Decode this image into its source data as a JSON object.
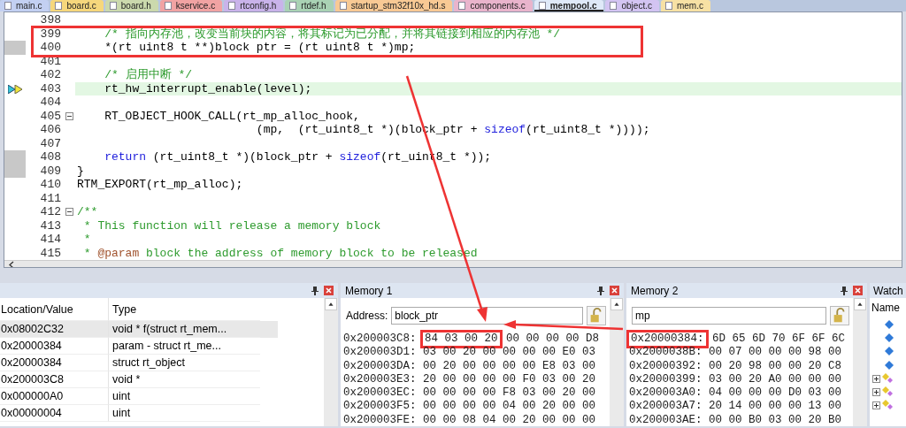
{
  "tabs": [
    {
      "label": "main.c",
      "color": "#c3d0f2",
      "selected": false
    },
    {
      "label": "board.c",
      "color": "#f6d77c",
      "selected": false
    },
    {
      "label": "board.h",
      "color": "#cbd9ad",
      "selected": false
    },
    {
      "label": "kservice.c",
      "color": "#f1a3a3",
      "selected": false
    },
    {
      "label": "rtconfig.h",
      "color": "#c9b3ea",
      "selected": false
    },
    {
      "label": "rtdef.h",
      "color": "#a9d2b4",
      "selected": false
    },
    {
      "label": "startup_stm32f10x_hd.s",
      "color": "#f8c994",
      "selected": false
    },
    {
      "label": "components.c",
      "color": "#e9b4cc",
      "selected": false
    },
    {
      "label": "mempool.c",
      "color": "#dfe9f8",
      "selected": true
    },
    {
      "label": "object.c",
      "color": "#d3c4f2",
      "selected": false
    },
    {
      "label": "mem.c",
      "color": "#f7e1a4",
      "selected": false
    }
  ],
  "editor": {
    "lines": [
      {
        "number": "398"
      },
      {
        "number": "399",
        "annotated": true,
        "tokens": [
          {
            "kind": "comment",
            "text": "    /* 指向内存池，改变当前块的内容，将其标记为已分配，并将其链接到相应的内存池 */"
          }
        ]
      },
      {
        "number": "400",
        "annotated": true,
        "gutter_mark": true,
        "tokens": [
          {
            "kind": "plain",
            "text": "    *(rt uint8 t **)block ptr = (rt uint8 t *)mp;"
          }
        ]
      },
      {
        "number": "401"
      },
      {
        "number": "402",
        "tokens": [
          {
            "kind": "comment",
            "text": "    /* 启用中断 */"
          }
        ]
      },
      {
        "number": "403",
        "current": true,
        "tokens": [
          {
            "kind": "plain",
            "text": "    rt_hw_interrupt_enable(level);"
          }
        ]
      },
      {
        "number": "404"
      },
      {
        "number": "405",
        "fold_expanded": true,
        "tokens": [
          {
            "kind": "plain",
            "text": "    RT_OBJECT_HOOK_CALL(rt_mp_alloc_hook,"
          }
        ]
      },
      {
        "number": "406",
        "tokens": [
          {
            "kind": "plain",
            "text": "                          (mp,  (rt_uint8_t *)(block_ptr + "
          },
          {
            "kind": "keyword",
            "text": "sizeof"
          },
          {
            "kind": "plain",
            "text": "(rt_uint8_t *))));"
          }
        ]
      },
      {
        "number": "407"
      },
      {
        "number": "408",
        "gutter_mark": true,
        "tokens": [
          {
            "kind": "keyword",
            "text": "    return"
          },
          {
            "kind": "plain",
            "text": " (rt_uint8_t *)(block_ptr + "
          },
          {
            "kind": "keyword",
            "text": "sizeof"
          },
          {
            "kind": "plain",
            "text": "(rt_uint8_t *));"
          }
        ]
      },
      {
        "number": "409",
        "gutter_mark": true,
        "tokens": [
          {
            "kind": "plain",
            "text": "}"
          }
        ]
      },
      {
        "number": "410",
        "tokens": [
          {
            "kind": "plain",
            "text": "RTM_EXPORT(rt_mp_alloc);"
          }
        ]
      },
      {
        "number": "411"
      },
      {
        "number": "412",
        "fold_expanded": true,
        "tokens": [
          {
            "kind": "comment",
            "text": "/**"
          }
        ]
      },
      {
        "number": "413",
        "tokens": [
          {
            "kind": "comment",
            "text": " * This function will release a memory block"
          }
        ]
      },
      {
        "number": "414",
        "tokens": [
          {
            "kind": "comment",
            "text": " *"
          }
        ]
      },
      {
        "number": "415",
        "tokens": [
          {
            "kind": "comment",
            "text": " * "
          },
          {
            "kind": "tag",
            "text": "@param"
          },
          {
            "kind": "comment",
            "text": " block the address of memory block to be released"
          }
        ]
      }
    ]
  },
  "call_stack": {
    "columns": [
      "Location/Value",
      "Type"
    ],
    "rows": [
      {
        "location": "0x08002C32",
        "type": "void * f(struct rt_mem...",
        "selected": true
      },
      {
        "location": "0x20000384",
        "type": "param - struct rt_me...",
        "selected": false
      },
      {
        "location": "0x20000384",
        "type": "struct rt_object",
        "selected": false
      },
      {
        "location": "0x200003C8",
        "type": "void *",
        "selected": false
      },
      {
        "location": "0x000000A0",
        "type": "uint",
        "selected": false
      },
      {
        "location": "0x00000004",
        "type": "uint",
        "selected": false
      }
    ]
  },
  "memory_1": {
    "title": "Memory 1",
    "address_label": "Address:",
    "address_value": "block_ptr",
    "rows": [
      {
        "address": "0x200003C8:",
        "boxed_bytes": "84 03 00 20",
        "bytes": "00 00 00 00 D8"
      },
      {
        "address": "0x200003D1:",
        "bytes": "03 00 20 00 00 00 00 E0 03"
      },
      {
        "address": "0x200003DA:",
        "bytes": "00 20 00 00 00 00 E8 03 00"
      },
      {
        "address": "0x200003E3:",
        "bytes": "20 00 00 00 00 F0 03 00 20"
      },
      {
        "address": "0x200003EC:",
        "bytes": "00 00 00 00 F8 03 00 20 00"
      },
      {
        "address": "0x200003F5:",
        "bytes": "00 00 00 00 04 00 20 00 00"
      },
      {
        "address": "0x200003FE:",
        "bytes": "00 00 08 04 00 20 00 00 00"
      }
    ]
  },
  "memory_2": {
    "title": "Memory 2",
    "address_value": "mp",
    "rows": [
      {
        "address": "0x20000384:",
        "address_boxed": true,
        "bytes": "6D 65 6D 70 6F 6F 6C"
      },
      {
        "address": "0x2000038B:",
        "bytes": "00 07 00 00 00 98 00"
      },
      {
        "address": "0x20000392:",
        "bytes": "00 20 98 00 00 20 C8"
      },
      {
        "address": "0x20000399:",
        "bytes": "03 00 20 A0 00 00 00"
      },
      {
        "address": "0x200003A0:",
        "bytes": "04 00 00 00 D0 03 00"
      },
      {
        "address": "0x200003A7:",
        "bytes": "20 14 00 00 00 13 00"
      },
      {
        "address": "0x200003AE:",
        "bytes": "00 00 B0 03 00 20 B0"
      }
    ]
  },
  "watch": {
    "title": "Watch",
    "column": "Name",
    "items": [
      {
        "kind": "value"
      },
      {
        "kind": "value"
      },
      {
        "kind": "value"
      },
      {
        "kind": "value"
      },
      {
        "kind": "struct",
        "expanded": false
      },
      {
        "kind": "struct",
        "expanded": false
      },
      {
        "kind": "struct",
        "expanded": false
      }
    ]
  }
}
